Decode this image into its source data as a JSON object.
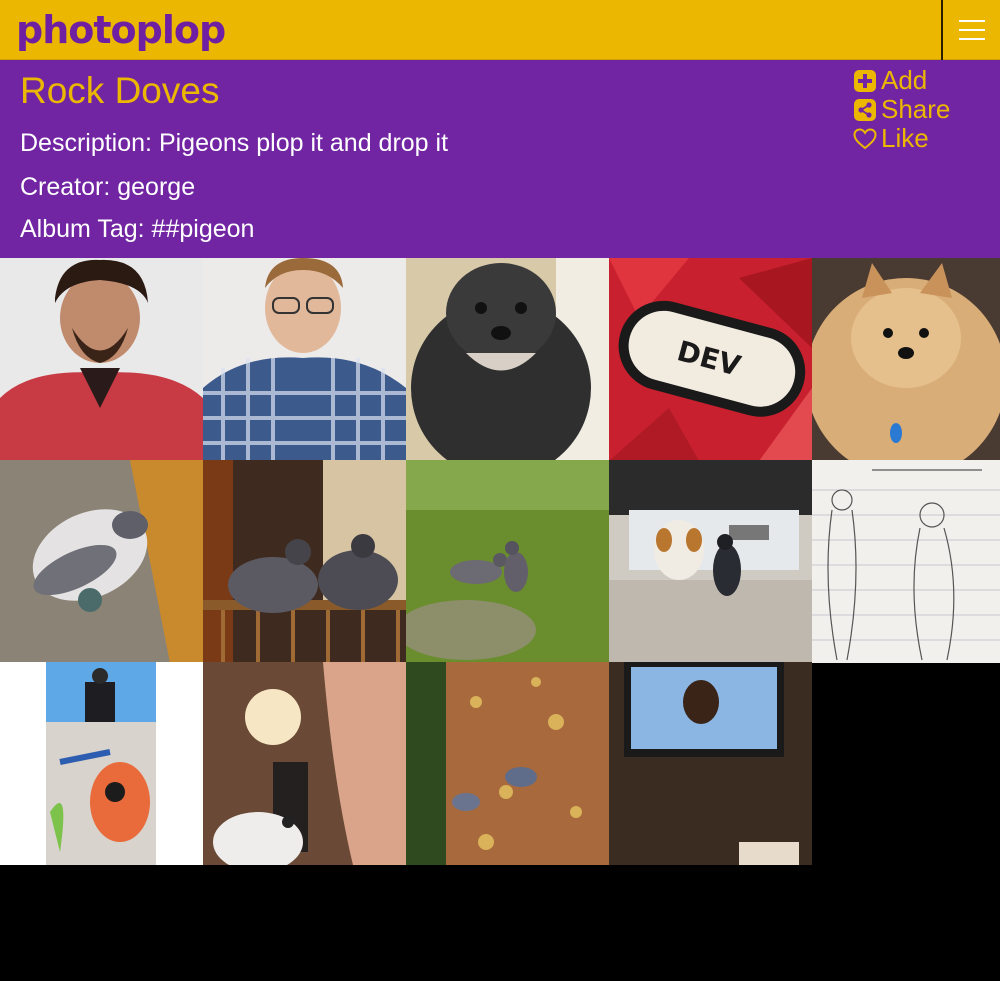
{
  "app": {
    "logo_text": "photoplop",
    "colors": {
      "topbar": "#ebb700",
      "header": "#7225a3",
      "accent": "#ebb700"
    }
  },
  "header": {
    "menu_icon": "hamburger-menu-icon"
  },
  "album": {
    "title": "Rock Doves",
    "description": "Description: Pigeons plop it and drop it",
    "creator": "Creator: george",
    "tag": "Album Tag: ##pigeon"
  },
  "actions": {
    "add_label": "Add",
    "share_label": "Share",
    "like_label": "Like"
  },
  "photos": [
    {
      "subject": "man-red-shirt"
    },
    {
      "subject": "man-plaid-shirt"
    },
    {
      "subject": "black-dog"
    },
    {
      "subject": "dev-bootcamp-logo"
    },
    {
      "subject": "pomeranian-dog"
    },
    {
      "subject": "pigeon-on-ground"
    },
    {
      "subject": "pigeons-on-railing"
    },
    {
      "subject": "pigeons-on-grass"
    },
    {
      "subject": "dog-and-pigeon-in-car"
    },
    {
      "subject": "pencil-sketch"
    },
    {
      "subject": "graffiti-wall"
    },
    {
      "subject": "woman-with-pigeon"
    },
    {
      "subject": "pigeons-on-wall"
    },
    {
      "subject": "tv-screen"
    }
  ]
}
